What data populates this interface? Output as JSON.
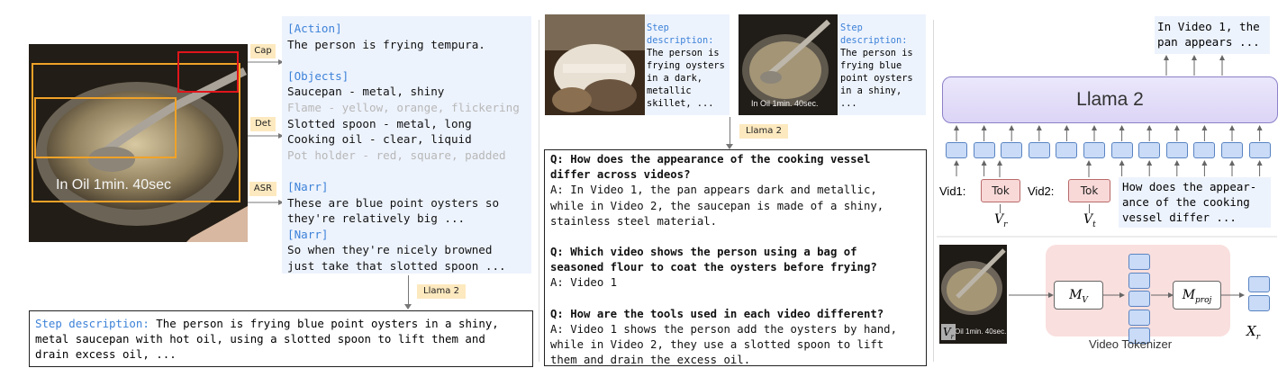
{
  "left": {
    "frame_overlay_text": "In Oil 1min. 40sec",
    "tags": {
      "cap": "Cap",
      "det": "Det",
      "asr": "ASR",
      "llama": "Llama 2"
    },
    "annot": [
      {
        "text": "[Action]",
        "color": "#3d82d8"
      },
      {
        "text": "The person is frying tempura.",
        "color": "#111111"
      },
      {
        "text": "",
        "color": "#111111"
      },
      {
        "text": "[Objects]",
        "color": "#3d82d8"
      },
      {
        "text": "Saucepan - metal, shiny",
        "color": "#111111"
      },
      {
        "text": "Flame - yellow, orange, flickering",
        "color": "#b7b7b7"
      },
      {
        "text": "Slotted spoon - metal, long",
        "color": "#111111"
      },
      {
        "text": "Cooking oil - clear, liquid",
        "color": "#111111"
      },
      {
        "text": "Pot holder - red, square, padded",
        "color": "#b7b7b7"
      },
      {
        "text": "",
        "color": "#111111"
      },
      {
        "text": "[Narr]",
        "color": "#3d82d8"
      },
      {
        "text": "These are blue point oysters so",
        "color": "#111111"
      },
      {
        "text": "they're relatively big ...",
        "color": "#111111"
      },
      {
        "text": "[Narr]",
        "color": "#3d82d8"
      },
      {
        "text": "So when they're nicely browned",
        "color": "#111111"
      },
      {
        "text": "just take that slotted spoon ...",
        "color": "#111111"
      }
    ],
    "step": {
      "label": "Step description:",
      "lines": [
        " The person is frying blue point oysters in a shiny,",
        "metal saucepan with hot oil, using a slotted spoon to lift them and",
        "drain excess oil, ..."
      ]
    }
  },
  "middle": {
    "clip1": {
      "label": [
        "Step",
        "description:"
      ],
      "text": [
        "The person is",
        "frying oysters",
        "in a dark,",
        "metallic",
        "skillet, ..."
      ]
    },
    "clip2": {
      "label": [
        "Step",
        "description:"
      ],
      "text": [
        "The person is",
        "frying blue",
        "point oysters",
        "in a shiny,",
        "..."
      ],
      "overlay": "In Oil 1min. 40sec."
    },
    "llama": "Llama 2",
    "qa": [
      {
        "q": [
          "Q: How does the appearance of the cooking vessel",
          "differ across videos?"
        ],
        "a": [
          "A: In Video 1, the pan appears dark and metallic,",
          "while in Video 2, the saucepan is made of a shiny,",
          "stainless steel material."
        ]
      },
      {
        "q": [
          "Q: Which video shows the person using a bag of",
          "seasoned flour to coat the oysters before frying?"
        ],
        "a": [
          "A: Video 1"
        ]
      },
      {
        "q": [
          "Q: How are the tools used in each video different?"
        ],
        "a": [
          "A: Video 1 shows the person add the oysters by hand,",
          "while in Video 2, they use a slotted spoon to lift",
          "them and drain the excess oil."
        ]
      }
    ]
  },
  "right": {
    "output": [
      "In Video 1, the",
      "pan appears ..."
    ],
    "llama": "Llama 2",
    "vid1": "Vid1:",
    "vid2": "Vid2:",
    "tok": "Tok",
    "vr": "V",
    "vr_sub": "r",
    "vt": "V",
    "vt_sub": "t",
    "question": [
      "How does the appear-",
      "ance of the cooking",
      "vessel differ ..."
    ],
    "mv": "M",
    "mv_sub": "V",
    "mproj": "M",
    "mproj_sub": "proj",
    "xr": "X",
    "xr_sub": "r",
    "frame_label": "V",
    "frame_label_sub": "r",
    "frame_overlay": "Oil 1min. 40sec.",
    "tokenizer_label": "Video Tokenizer"
  }
}
